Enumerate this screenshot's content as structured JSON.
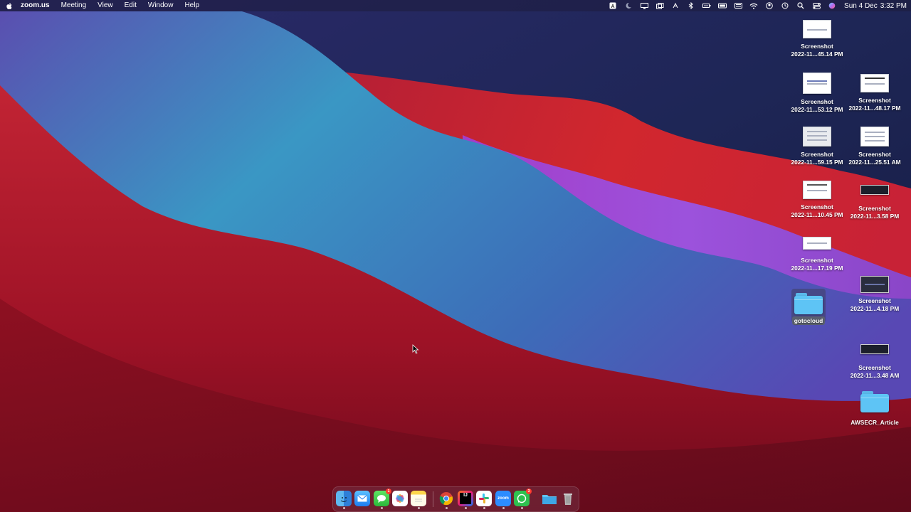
{
  "menubar": {
    "app_name": "zoom.us",
    "menus": [
      "Meeting",
      "View",
      "Edit",
      "Window",
      "Help"
    ],
    "status_icons": [
      "text-input-icon",
      "moon-icon",
      "display-icon",
      "screen-mirror-icon",
      "touch-id-icon",
      "bluetooth-icon",
      "battery-dots-icon",
      "battery-icon",
      "keyboard-icon",
      "wifi-icon",
      "user-icon",
      "time-machine-icon",
      "search-icon",
      "control-center-icon",
      "siri-icon"
    ],
    "date": "Sun 4 Dec",
    "time": "3:32 PM"
  },
  "desktop": {
    "items": [
      {
        "name": "Screenshot",
        "sub": "2022-11...45.14 PM"
      },
      {
        "name": "Screenshot",
        "sub": "2022-11...53.12 PM"
      },
      {
        "name": "Screenshot",
        "sub": "2022-11...48.17 PM"
      },
      {
        "name": "Screenshot",
        "sub": "2022-11...59.15 PM"
      },
      {
        "name": "Screenshot",
        "sub": "2022-11...25.51 AM"
      },
      {
        "name": "Screenshot",
        "sub": "2022-11...10.45 PM"
      },
      {
        "name": "Screenshot",
        "sub": "2022-11...3.58 PM"
      },
      {
        "name": "Screenshot",
        "sub": "2022-11...17.19 PM"
      },
      {
        "name": "Screenshot",
        "sub": "2022-11...4.18 PM"
      },
      {
        "name": "Screenshot",
        "sub": "2022-11...3.48 AM"
      }
    ],
    "folders": [
      {
        "name": "gotocloud"
      },
      {
        "name": "AWSECR_Article"
      }
    ]
  },
  "dock": {
    "apps": [
      "Finder",
      "Mail",
      "Messages",
      "Photos",
      "Notes",
      "Chrome",
      "IntelliJ IDEA",
      "Slack",
      "Zoom",
      "WhatsApp",
      "Files",
      "Trash"
    ],
    "zoom_label": "zoom",
    "intellij_label": "IJ",
    "messages_badge": "1",
    "whatsapp_badge": "3"
  },
  "colors": {
    "folder_blue": "#5ec4f5",
    "wallpaper_teal": "#3a97c4",
    "wallpaper_red": "#c8222e",
    "wallpaper_purple": "#9a4fd6"
  }
}
